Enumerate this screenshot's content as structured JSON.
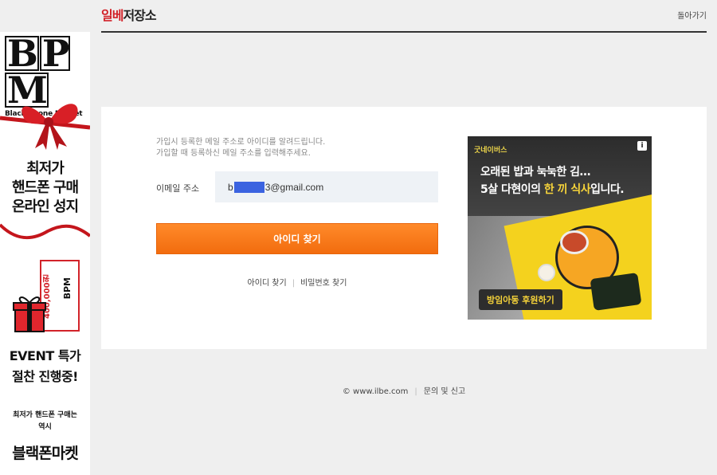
{
  "left_ad": {
    "logo_letters": [
      "B",
      "P",
      "M"
    ],
    "logo_sub": "Black Phone Market",
    "headline": [
      "최저가",
      "핸드폰 구매",
      "온라인 성지"
    ],
    "coupon_amount": "400,000원",
    "coupon_brand": "BPM",
    "event": [
      "EVENT 특가",
      "절찬 진행중!"
    ],
    "small": [
      "최저가 핸드폰 구매는",
      "역시"
    ],
    "brand": "블랙폰마켓"
  },
  "header": {
    "logo_red": "일베",
    "logo_dark": "저장소",
    "back_label": "돌아가기"
  },
  "form": {
    "info_line1": "가입시 등록한 메일 주소로 아이디를 알려드립니다.",
    "info_line2": "가입할 때 등록하신 메일 주소를 입력해주세요.",
    "email_label": "이메일 주소",
    "email_prefix": "b",
    "email_suffix": "3@gmail.com",
    "button_label": "아이디 찾기",
    "link_find_id": "아이디 찾기",
    "link_find_pw": "비밀번호 찾기"
  },
  "right_ad": {
    "brand": "굿네이버스",
    "info": "i",
    "line1": "오래된 밥과 눅눅한 김…",
    "line2_pre": "5살 다현이의 ",
    "line2_hl": "한 끼 식사",
    "line2_post": "입니다.",
    "cta": "방임아동 후원하기"
  },
  "footer": {
    "copyright": "© www.ilbe.com",
    "contact": "문의 및 신고"
  },
  "colors": {
    "accent": "#f26c0e",
    "logo_red": "#d2232a",
    "input_bg": "#eef2f6"
  }
}
